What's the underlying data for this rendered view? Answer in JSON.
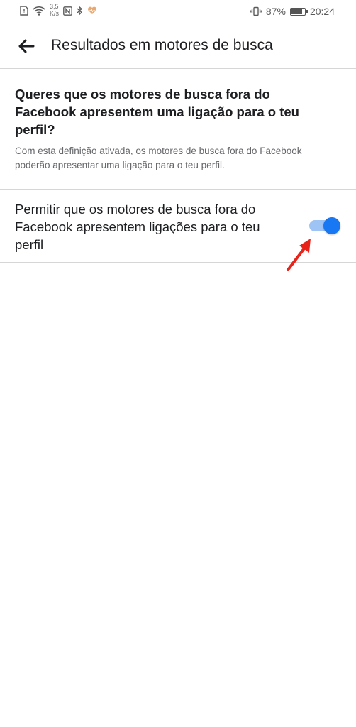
{
  "status_bar": {
    "speed_value": "3,5",
    "speed_unit": "K/s",
    "battery": "87%",
    "time": "20:24",
    "battery_level": 0.87
  },
  "header": {
    "title": "Resultados em motores de busca",
    "back_icon": "arrow-left-icon"
  },
  "section": {
    "question": "Queres que os motores de busca fora do Facebook apresentem uma ligação para o teu perfil?",
    "description": "Com esta definição ativada, os motores de busca fora do Facebook poderão apresentar uma ligação para o teu perfil."
  },
  "setting": {
    "label": "Permitir que os motores de busca fora do Facebook apresentem ligações para o teu perfil",
    "enabled": true
  },
  "colors": {
    "toggle_on": "#1877f2",
    "toggle_track": "#9ec3f5",
    "annotation_arrow": "#e8231a"
  }
}
